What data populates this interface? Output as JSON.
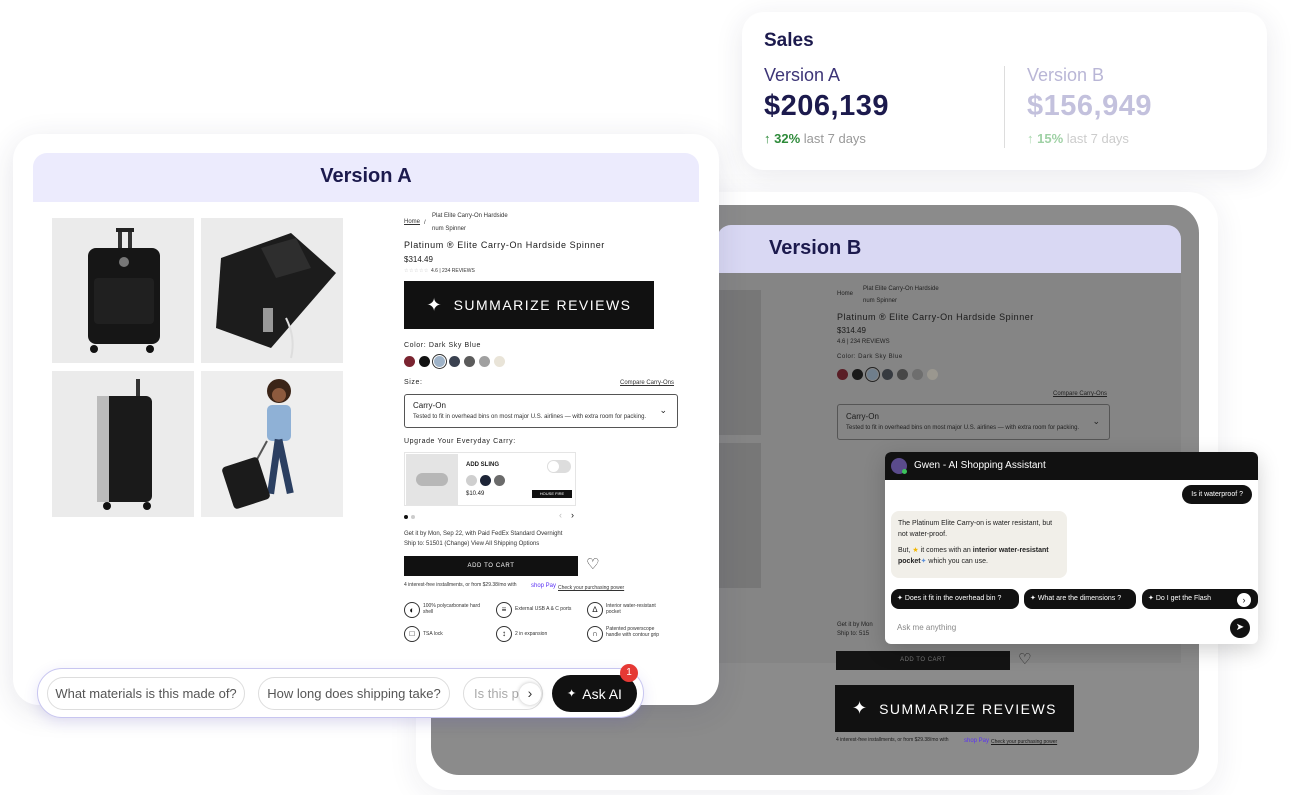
{
  "sales": {
    "title": "Sales",
    "a": {
      "label": "Version A",
      "value": "$206,139",
      "change": "32%",
      "period": "last 7 days"
    },
    "b": {
      "label": "Version B",
      "value": "$156,949",
      "change": "15%",
      "period": "last 7 days"
    }
  },
  "versionA": {
    "header": "Version A",
    "breadcrumb": {
      "home": "Home",
      "sep": "/",
      "item_line1": "Plat    Elite Carry-On Hardside",
      "item_line2": "num   Spinner"
    },
    "product_title": "Platinum ® Elite Carry-On Hardside Spinner",
    "price": "$314.49",
    "rating_text": "4.6  |  234 REVIEWS",
    "summarize_button": "SUMMARIZE REVIEWS",
    "color_label": "Color: Dark Sky Blue",
    "swatches": [
      "#7a2430",
      "#111111",
      "#9fb3c8",
      "#3a4150",
      "#5b5b5b",
      "#a0a0a0",
      "#e9e4d8"
    ],
    "size_label": "Size:",
    "compare_link": "Compare Carry-Ons",
    "size_option": "Carry-On",
    "size_desc": "Tested to fit in overhead bins on most major U.S. airlines — with extra room for packing.",
    "upgrade_label": "Upgrade Your Everyday Carry:",
    "addon_title": "ADD SLING",
    "addon_price": "$10.49",
    "addon_tag": "HOUSE FIRE",
    "delivery_line": "Get it by Mon, Sep 22, with Paid FedEx Standard Overnight",
    "ship_line": "Ship to: 51501 (Change)  View All Shipping Options",
    "add_to_cart": "ADD TO CART",
    "installments": "4 interest-free installments, or from $29.38/mo with",
    "shop_pay": "shop Pay",
    "purchasing_power": "Check your purchasing power",
    "features": [
      "100% polycarbonate hard shell",
      "External USB A & C ports",
      "Interior water-resistant pocket",
      "TSA lock",
      "2 in expansion",
      "Patented powerscope handle with contour grip"
    ],
    "bottom_chips": [
      "What materials is this made of?",
      "How long does shipping take?",
      "Is this p"
    ],
    "ask_ai": "Ask AI",
    "ask_badge": "1"
  },
  "versionB": {
    "header": "Version B",
    "breadcrumb_home": "Home",
    "breadcrumb_item": "Plat    Elite Carry-On Hardside",
    "breadcrumb_item2": "num   Spinner",
    "product_title": "Platinum ® Elite Carry-On Hardside Spinner",
    "price": "$314.49",
    "rating_text": "4.6  |  234 REVIEWS",
    "color_label": "Color: Dark Sky Blue",
    "compare_link": "Compare Carry-Ons",
    "size_option": "Carry-On",
    "size_desc": "Tested to fit in overhead bins on most major U.S. airlines — with extra room for packing.",
    "get_it": "Get it by Mon",
    "ship_to": "Ship to: 515",
    "add_to_cart": "ADD TO CART",
    "summarize_button": "SUMMARIZE REVIEWS",
    "installments": "4 interest-free installments, or from $29.38/mo with",
    "shop_pay": "shop Pay",
    "purchasing_power": "Check your purchasing power"
  },
  "chat": {
    "title": "Gwen - AI Shopping Assistant",
    "user_msg": "Is it waterproof ?",
    "bot_p1": "The Platinum Elite Carry-on is water resistant, but not water-proof.",
    "bot_p2_pre": "But, ",
    "bot_p2_bold": "interior water-resistant pocket",
    "bot_p2_mid": " it comes with an ",
    "bot_p2_post": " which you can use.",
    "suggestions": [
      "Does it fit in the overhead bin ?",
      "What are the dimensions ?",
      "Do I get the Flash"
    ],
    "input_placeholder": "Ask me anything"
  },
  "colors": {
    "navy": "#1c1a4d",
    "purple": "#3d3577",
    "green": "#2e8b3a",
    "lavender": "#ecebfd",
    "lavender_b": "#d9d8f3"
  }
}
